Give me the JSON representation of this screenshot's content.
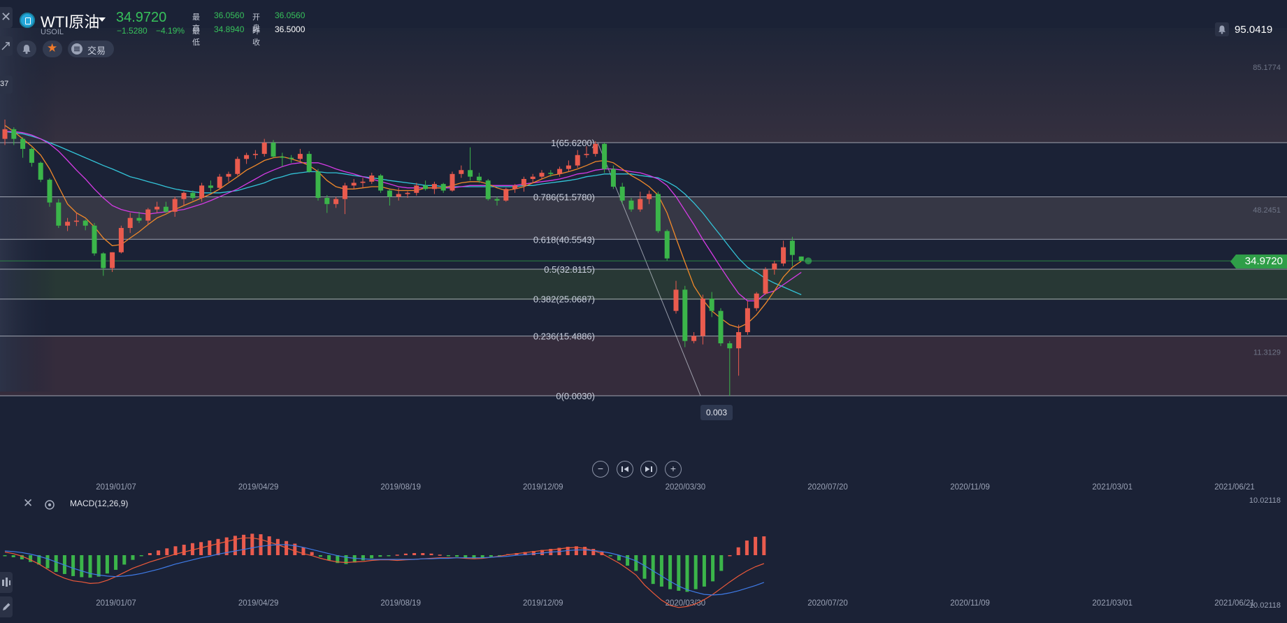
{
  "header": {
    "symbol_name": "WTI原油",
    "symbol_code": "USOIL",
    "last_price": "34.9720",
    "change": "−1.5280",
    "change_pct": "−4.19%",
    "high_label": "最高",
    "high_value": "36.0560",
    "open_label": "开盘",
    "open_value": "36.0560",
    "low_label": "最低",
    "low_value": "34.8940",
    "prev_close_label": "昨收",
    "prev_close_value": "36.5000",
    "trade_button": "交易",
    "alert_value": "95.0419",
    "left_partial_label": "37"
  },
  "colors": {
    "background": "#1b2236",
    "up": "#ea5b4e",
    "down": "#3bb54a",
    "ma_fast": "#f0892a",
    "ma_mid": "#d63be6",
    "ma_slow": "#33c4d8",
    "macd_line": "#ef5a3a",
    "signal_line": "#3f7be8",
    "price_tag": "#2f9e48"
  },
  "icons": {
    "close": "close-icon",
    "alert": "bell-icon",
    "favorite": "star-icon",
    "trade": "list-icon",
    "settings": "gear-icon",
    "zoom_out": "minus-icon",
    "zoom_in": "plus-icon",
    "prev": "skip-back-icon",
    "next": "skip-forward-icon"
  },
  "chart_data": [
    {
      "type": "candlestick",
      "title": "WTI原油",
      "x_tick_labels": [
        "2019/01/07",
        "2019/04/29",
        "2019/08/19",
        "2019/12/09",
        "2020/03/30",
        "2020/07/20",
        "2020/11/09",
        "2021/03/01",
        "2021/06/21"
      ],
      "ylim": [
        -20,
        100
      ],
      "y_tick_labels": [
        "85.1774",
        "48.2451",
        "11.3129"
      ],
      "last_price_label": "34.9720",
      "last_price": 34.972,
      "low_marker_label": "0.003",
      "fibonacci": {
        "levels": [
          {
            "label": "1(65.6200)",
            "value": 65.62
          },
          {
            "label": "0.786(51.5780)",
            "value": 51.578
          },
          {
            "label": "0.618(40.5543)",
            "value": 40.5543
          },
          {
            "label": "0.5(32.8115)",
            "value": 32.8115
          },
          {
            "label": "0.382(25.0687)",
            "value": 25.0687
          },
          {
            "label": "0.236(15.4886)",
            "value": 15.4886
          },
          {
            "label": "0(0.0030)",
            "value": 0.003
          }
        ]
      },
      "candles": [
        {
          "o": 66.6,
          "h": 71.6,
          "l": 65.0,
          "c": 69.1
        },
        {
          "o": 69.1,
          "h": 69.6,
          "l": 65.0,
          "c": 66.6
        },
        {
          "o": 66.6,
          "h": 67.0,
          "l": 61.7,
          "c": 64.0
        },
        {
          "o": 64.0,
          "h": 64.4,
          "l": 59.4,
          "c": 60.4
        },
        {
          "o": 60.4,
          "h": 60.7,
          "l": 55.4,
          "c": 56.0
        },
        {
          "o": 56.0,
          "h": 56.4,
          "l": 49.0,
          "c": 50.1
        },
        {
          "o": 50.1,
          "h": 51.0,
          "l": 43.5,
          "c": 44.1
        },
        {
          "o": 44.1,
          "h": 46.1,
          "l": 42.7,
          "c": 45.1
        },
        {
          "o": 45.1,
          "h": 47.4,
          "l": 44.0,
          "c": 45.4
        },
        {
          "o": 45.4,
          "h": 45.7,
          "l": 42.9,
          "c": 44.1
        },
        {
          "o": 44.1,
          "h": 44.8,
          "l": 36.3,
          "c": 36.9
        },
        {
          "o": 36.9,
          "h": 37.2,
          "l": 31.1,
          "c": 33.1
        },
        {
          "o": 33.1,
          "h": 37.2,
          "l": 32.1,
          "c": 37.2
        },
        {
          "o": 37.2,
          "h": 44.1,
          "l": 36.9,
          "c": 43.5
        },
        {
          "o": 43.5,
          "h": 47.4,
          "l": 42.2,
          "c": 46.1
        },
        {
          "o": 46.1,
          "h": 47.7,
          "l": 44.8,
          "c": 45.4
        },
        {
          "o": 45.4,
          "h": 48.7,
          "l": 44.4,
          "c": 48.3
        },
        {
          "o": 48.3,
          "h": 50.3,
          "l": 47.4,
          "c": 49.0
        },
        {
          "o": 49.0,
          "h": 50.3,
          "l": 47.4,
          "c": 47.7
        },
        {
          "o": 47.7,
          "h": 51.6,
          "l": 46.4,
          "c": 51.0
        },
        {
          "o": 51.0,
          "h": 53.0,
          "l": 49.3,
          "c": 52.6
        },
        {
          "o": 52.6,
          "h": 53.2,
          "l": 50.6,
          "c": 51.3
        },
        {
          "o": 51.3,
          "h": 55.2,
          "l": 50.3,
          "c": 54.5
        },
        {
          "o": 54.5,
          "h": 55.8,
          "l": 52.9,
          "c": 53.9
        },
        {
          "o": 53.9,
          "h": 57.5,
          "l": 53.6,
          "c": 56.8
        },
        {
          "o": 56.8,
          "h": 58.1,
          "l": 55.5,
          "c": 57.5
        },
        {
          "o": 57.5,
          "h": 62.0,
          "l": 57.1,
          "c": 61.4
        },
        {
          "o": 61.4,
          "h": 63.0,
          "l": 60.1,
          "c": 62.4
        },
        {
          "o": 62.4,
          "h": 63.7,
          "l": 61.4,
          "c": 62.7
        },
        {
          "o": 62.7,
          "h": 66.6,
          "l": 62.0,
          "c": 65.6
        },
        {
          "o": 65.6,
          "h": 66.3,
          "l": 61.7,
          "c": 62.0
        },
        {
          "o": 62.0,
          "h": 63.0,
          "l": 59.4,
          "c": 61.7
        },
        {
          "o": 61.7,
          "h": 62.4,
          "l": 60.4,
          "c": 61.4
        },
        {
          "o": 61.4,
          "h": 64.0,
          "l": 60.7,
          "c": 62.7
        },
        {
          "o": 62.7,
          "h": 63.4,
          "l": 57.8,
          "c": 58.1
        },
        {
          "o": 58.1,
          "h": 58.8,
          "l": 50.6,
          "c": 51.3
        },
        {
          "o": 51.3,
          "h": 52.0,
          "l": 47.4,
          "c": 49.7
        },
        {
          "o": 49.7,
          "h": 51.6,
          "l": 48.7,
          "c": 51.0
        },
        {
          "o": 51.0,
          "h": 55.2,
          "l": 47.1,
          "c": 54.5
        },
        {
          "o": 54.5,
          "h": 56.2,
          "l": 53.6,
          "c": 55.2
        },
        {
          "o": 55.2,
          "h": 56.5,
          "l": 53.9,
          "c": 55.5
        },
        {
          "o": 55.5,
          "h": 57.8,
          "l": 54.9,
          "c": 57.1
        },
        {
          "o": 57.1,
          "h": 57.5,
          "l": 52.6,
          "c": 53.2
        },
        {
          "o": 53.2,
          "h": 53.6,
          "l": 49.3,
          "c": 51.6
        },
        {
          "o": 51.6,
          "h": 53.9,
          "l": 50.6,
          "c": 52.3
        },
        {
          "o": 52.3,
          "h": 53.0,
          "l": 51.3,
          "c": 52.6
        },
        {
          "o": 52.6,
          "h": 55.2,
          "l": 51.9,
          "c": 54.5
        },
        {
          "o": 54.5,
          "h": 55.8,
          "l": 53.2,
          "c": 53.6
        },
        {
          "o": 53.6,
          "h": 55.5,
          "l": 52.3,
          "c": 54.9
        },
        {
          "o": 54.9,
          "h": 55.2,
          "l": 52.6,
          "c": 53.2
        },
        {
          "o": 53.2,
          "h": 58.1,
          "l": 52.9,
          "c": 57.5
        },
        {
          "o": 57.5,
          "h": 59.7,
          "l": 56.5,
          "c": 58.5
        },
        {
          "o": 58.5,
          "h": 64.4,
          "l": 55.8,
          "c": 56.8
        },
        {
          "o": 56.8,
          "h": 57.8,
          "l": 55.2,
          "c": 55.8
        },
        {
          "o": 55.8,
          "h": 56.2,
          "l": 50.6,
          "c": 51.0
        },
        {
          "o": 51.0,
          "h": 51.6,
          "l": 49.3,
          "c": 50.6
        },
        {
          "o": 50.6,
          "h": 53.9,
          "l": 50.3,
          "c": 53.6
        },
        {
          "o": 53.6,
          "h": 54.9,
          "l": 52.6,
          "c": 54.5
        },
        {
          "o": 54.5,
          "h": 56.8,
          "l": 52.9,
          "c": 56.2
        },
        {
          "o": 56.2,
          "h": 57.5,
          "l": 55.2,
          "c": 56.8
        },
        {
          "o": 56.8,
          "h": 58.5,
          "l": 56.2,
          "c": 57.8
        },
        {
          "o": 57.8,
          "h": 58.5,
          "l": 56.8,
          "c": 57.5
        },
        {
          "o": 57.5,
          "h": 59.4,
          "l": 56.8,
          "c": 58.8
        },
        {
          "o": 58.8,
          "h": 61.0,
          "l": 58.1,
          "c": 59.7
        },
        {
          "o": 59.7,
          "h": 63.7,
          "l": 59.1,
          "c": 62.4
        },
        {
          "o": 62.4,
          "h": 64.7,
          "l": 61.7,
          "c": 62.7
        },
        {
          "o": 62.7,
          "h": 66.0,
          "l": 62.0,
          "c": 65.3
        },
        {
          "o": 65.3,
          "h": 65.6,
          "l": 57.8,
          "c": 58.8
        },
        {
          "o": 58.8,
          "h": 59.7,
          "l": 53.6,
          "c": 54.2
        },
        {
          "o": 54.2,
          "h": 55.2,
          "l": 49.7,
          "c": 50.6
        },
        {
          "o": 50.6,
          "h": 51.3,
          "l": 47.7,
          "c": 48.3
        },
        {
          "o": 48.3,
          "h": 52.9,
          "l": 47.7,
          "c": 51.0
        },
        {
          "o": 51.0,
          "h": 53.2,
          "l": 49.7,
          "c": 52.3
        },
        {
          "o": 52.3,
          "h": 52.9,
          "l": 42.2,
          "c": 42.7
        },
        {
          "o": 42.7,
          "h": 43.1,
          "l": 35.0,
          "c": 35.6
        },
        {
          "o": 22.0,
          "h": 29.8,
          "l": 21.3,
          "c": 27.5
        },
        {
          "o": 27.5,
          "h": 28.5,
          "l": 12.6,
          "c": 14.2
        },
        {
          "o": 14.2,
          "h": 16.5,
          "l": 13.6,
          "c": 15.5
        },
        {
          "o": 15.5,
          "h": 26.2,
          "l": 13.3,
          "c": 25.2
        },
        {
          "o": 25.2,
          "h": 26.9,
          "l": 20.4,
          "c": 22.0
        },
        {
          "o": 22.0,
          "h": 22.7,
          "l": 12.9,
          "c": 13.6
        },
        {
          "o": 13.6,
          "h": 14.2,
          "l": 0.0,
          "c": 12.3
        },
        {
          "o": 12.3,
          "h": 18.4,
          "l": 5.2,
          "c": 16.5
        },
        {
          "o": 16.5,
          "h": 24.6,
          "l": 15.8,
          "c": 22.7
        },
        {
          "o": 22.7,
          "h": 26.9,
          "l": 22.0,
          "c": 26.5
        },
        {
          "o": 26.5,
          "h": 33.3,
          "l": 26.2,
          "c": 32.7
        },
        {
          "o": 32.7,
          "h": 35.0,
          "l": 31.4,
          "c": 34.3
        },
        {
          "o": 34.3,
          "h": 40.2,
          "l": 33.6,
          "c": 38.5
        },
        {
          "o": 40.2,
          "h": 41.2,
          "l": 33.6,
          "c": 36.5
        },
        {
          "o": 36.1,
          "h": 36.1,
          "l": 34.9,
          "c": 35.0
        }
      ],
      "ma_fast": [
        70.1,
        68.5,
        66.6,
        64.7,
        62.4,
        58.8,
        54.2,
        49.7,
        47.4,
        46.1,
        43.8,
        40.9,
        38.9,
        39.2,
        40.9,
        42.5,
        44.4,
        46.1,
        47.1,
        48.3,
        49.3,
        50.3,
        51.3,
        52.3,
        53.6,
        55.2,
        56.8,
        58.5,
        59.7,
        61.0,
        61.7,
        62.0,
        61.4,
        60.7,
        59.7,
        58.1,
        55.8,
        54.2,
        53.6,
        53.6,
        53.9,
        54.2,
        54.2,
        53.6,
        53.2,
        53.2,
        53.2,
        53.9,
        53.9,
        53.9,
        54.5,
        55.2,
        55.5,
        55.5,
        54.9,
        53.9,
        53.2,
        53.6,
        54.2,
        55.2,
        56.2,
        57.1,
        57.5,
        58.1,
        58.8,
        59.7,
        60.7,
        61.0,
        60.4,
        58.8,
        57.1,
        55.8,
        54.2,
        52.0,
        47.4,
        40.9,
        34.6,
        28.5,
        24.9,
        22.0,
        20.1,
        18.4,
        17.7,
        18.8,
        21.0,
        23.9,
        27.2,
        30.8,
        33.3,
        34.9
      ],
      "ma_mid": [
        68.5,
        68.5,
        68.2,
        67.6,
        66.6,
        65.3,
        63.4,
        61.0,
        58.5,
        56.2,
        53.6,
        51.3,
        49.3,
        48.3,
        47.7,
        47.4,
        47.1,
        47.4,
        47.7,
        48.0,
        48.3,
        49.0,
        49.7,
        50.6,
        51.6,
        52.6,
        53.6,
        54.9,
        56.2,
        57.5,
        58.5,
        59.4,
        60.1,
        60.4,
        60.4,
        60.4,
        59.7,
        58.8,
        58.1,
        57.5,
        56.8,
        56.2,
        55.5,
        54.9,
        54.2,
        53.9,
        53.9,
        53.9,
        53.9,
        53.9,
        53.9,
        54.2,
        54.5,
        54.5,
        54.5,
        54.5,
        54.5,
        54.5,
        54.9,
        55.2,
        55.5,
        55.8,
        56.2,
        56.8,
        57.5,
        57.8,
        58.5,
        58.8,
        58.8,
        58.5,
        58.1,
        57.8,
        57.1,
        56.2,
        54.5,
        51.6,
        48.0,
        44.4,
        40.5,
        36.9,
        33.3,
        29.8,
        26.5,
        24.6,
        24.6,
        26.5,
        27.2,
        28.8,
        30.4,
        32.0
      ],
      "ma_slow": [
        68.5,
        68.2,
        67.9,
        67.3,
        66.6,
        65.6,
        64.7,
        63.7,
        62.7,
        61.7,
        60.7,
        59.7,
        58.8,
        57.8,
        56.8,
        56.2,
        55.5,
        54.9,
        54.2,
        53.6,
        53.2,
        52.9,
        52.6,
        52.6,
        52.6,
        52.9,
        53.2,
        53.9,
        54.5,
        55.2,
        56.2,
        56.8,
        57.5,
        57.8,
        58.1,
        58.1,
        57.8,
        57.8,
        57.5,
        57.1,
        56.8,
        56.5,
        56.2,
        55.8,
        55.5,
        55.2,
        54.9,
        54.5,
        54.5,
        54.2,
        54.2,
        54.2,
        54.2,
        54.2,
        54.2,
        54.2,
        54.2,
        54.2,
        54.5,
        54.5,
        54.9,
        55.2,
        55.5,
        55.8,
        56.2,
        56.8,
        57.1,
        57.5,
        57.5,
        57.5,
        57.5,
        57.1,
        56.8,
        56.5,
        55.5,
        54.2,
        52.3,
        50.0,
        47.4,
        44.4,
        41.5,
        38.5,
        35.6,
        33.3,
        32.0,
        30.4,
        29.2,
        28.2,
        27.2,
        26.2
      ]
    },
    {
      "type": "macd",
      "title": "MACD(12,26,9)",
      "x_tick_labels": [
        "2019/01/07",
        "2019/04/29",
        "2019/08/19",
        "2019/12/09",
        "2020/03/30",
        "2020/07/20",
        "2020/11/09",
        "2021/03/01",
        "2021/06/21"
      ],
      "ylim": [
        -10.02118,
        10.02118
      ],
      "y_tick_labels": [
        "10.02118",
        "−10.02118"
      ],
      "histogram": [
        -0.2,
        -0.4,
        -0.8,
        -1.3,
        -1.8,
        -2.5,
        -3.2,
        -3.6,
        -4.0,
        -4.2,
        -4.3,
        -4.1,
        -3.5,
        -2.8,
        -1.8,
        -0.9,
        -0.2,
        0.4,
        0.9,
        1.3,
        1.7,
        2.0,
        2.3,
        2.5,
        2.8,
        3.1,
        3.4,
        3.7,
        3.9,
        4.1,
        4.0,
        3.6,
        3.1,
        2.7,
        2.2,
        1.5,
        0.6,
        -0.3,
        -1.0,
        -1.5,
        -1.7,
        -1.4,
        -1.0,
        -0.6,
        -0.3,
        -0.1,
        0.1,
        0.3,
        0.4,
        0.4,
        0.3,
        0.1,
        -0.1,
        -0.3,
        -0.5,
        -0.6,
        -0.5,
        -0.3,
        -0.1,
        0.2,
        0.4,
        0.6,
        0.8,
        1.0,
        1.2,
        1.4,
        1.6,
        1.7,
        1.6,
        1.2,
        0.6,
        -0.2,
        -1.0,
        -2.0,
        -3.0,
        -4.5,
        -5.5,
        -6.0,
        -6.5,
        -6.8,
        -7.0,
        -6.5,
        -6.0,
        -5.0,
        -3.0,
        0.0,
        1.5,
        2.8,
        3.5,
        3.6
      ],
      "macd_line": [
        0.6,
        0.3,
        -0.2,
        -0.9,
        -1.7,
        -2.7,
        -3.7,
        -4.4,
        -4.9,
        -5.1,
        -5.4,
        -5.3,
        -4.8,
        -4.1,
        -3.3,
        -2.5,
        -1.9,
        -1.3,
        -0.8,
        -0.3,
        0.2,
        0.6,
        1.0,
        1.4,
        1.8,
        2.2,
        2.6,
        3.0,
        3.3,
        3.3,
        3.0,
        2.5,
        2.0,
        1.4,
        0.8,
        0.3,
        -0.1,
        -0.6,
        -1.0,
        -1.3,
        -1.4,
        -1.3,
        -1.2,
        -1.0,
        -0.9,
        -0.9,
        -1.0,
        -0.9,
        -0.8,
        -0.7,
        -0.6,
        -0.5,
        -0.5,
        -0.5,
        -0.6,
        -0.7,
        -0.6,
        -0.4,
        -0.2,
        0.1,
        0.3,
        0.5,
        0.7,
        0.9,
        1.0,
        1.2,
        1.4,
        1.5,
        1.3,
        0.9,
        0.3,
        -0.6,
        -1.5,
        -2.6,
        -3.8,
        -5.7,
        -7.2,
        -8.6,
        -9.6,
        -10.0,
        -9.8,
        -9.3,
        -8.5,
        -7.5,
        -6.3,
        -5.1,
        -4.0,
        -3.0,
        -2.2,
        -1.6
      ],
      "signal_line": [
        0.8,
        0.7,
        0.5,
        0.2,
        -0.2,
        -0.7,
        -1.3,
        -1.9,
        -2.5,
        -3.0,
        -3.5,
        -3.8,
        -4.0,
        -4.1,
        -4.0,
        -3.8,
        -3.5,
        -3.1,
        -2.7,
        -2.2,
        -1.7,
        -1.3,
        -0.9,
        -0.5,
        -0.2,
        0.2,
        0.5,
        0.8,
        1.1,
        1.4,
        1.7,
        1.9,
        2.0,
        2.0,
        1.8,
        1.5,
        1.1,
        0.7,
        0.3,
        -0.1,
        -0.4,
        -0.6,
        -0.7,
        -0.8,
        -0.8,
        -0.8,
        -0.8,
        -0.8,
        -0.8,
        -0.7,
        -0.7,
        -0.6,
        -0.6,
        -0.5,
        -0.5,
        -0.5,
        -0.5,
        -0.4,
        -0.3,
        -0.2,
        0.0,
        0.1,
        0.3,
        0.4,
        0.6,
        0.7,
        0.9,
        1.0,
        1.0,
        0.9,
        0.7,
        0.4,
        0.0,
        -0.5,
        -1.1,
        -2.0,
        -3.0,
        -4.0,
        -5.0,
        -5.9,
        -6.6,
        -7.1,
        -7.5,
        -7.6,
        -7.5,
        -7.2,
        -6.8,
        -6.3,
        -5.8,
        -5.2
      ]
    }
  ]
}
